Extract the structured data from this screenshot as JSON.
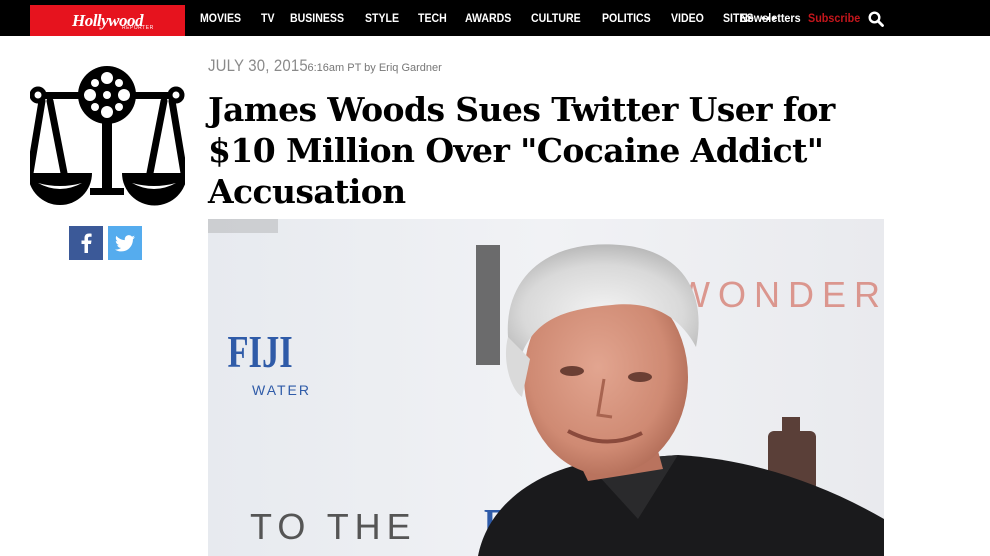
{
  "header": {
    "logo_text": "Hollywood",
    "logo_subtext": "REPORTER",
    "nav_items": [
      "MOVIES",
      "TV",
      "BUSINESS",
      "STYLE",
      "TECH",
      "AWARDS",
      "CULTURE",
      "POLITICS",
      "VIDEO",
      "SITES"
    ],
    "more_label": "•••",
    "newsletters_label": "Newsletters",
    "subscribe_label": "Subscribe"
  },
  "sidebar": {
    "section_icon": "scales-of-justice-film-reel-icon",
    "share": [
      "facebook-icon",
      "twitter-icon"
    ]
  },
  "article": {
    "date": "JULY 30, 2015",
    "meta": "6:16am PT by Eriq Gardner",
    "headline": "James Woods Sues Twitter User for $10 Million Over \"Cocaine Addict\" Accusation"
  },
  "photo": {
    "backdrop_texts": [
      "FIJI",
      "WATER",
      "TO THE",
      "WONDER"
    ]
  },
  "colors": {
    "brand_red": "#e6131e",
    "subscribe_red": "#c4161c",
    "facebook": "#3b5998",
    "twitter": "#55acee"
  }
}
